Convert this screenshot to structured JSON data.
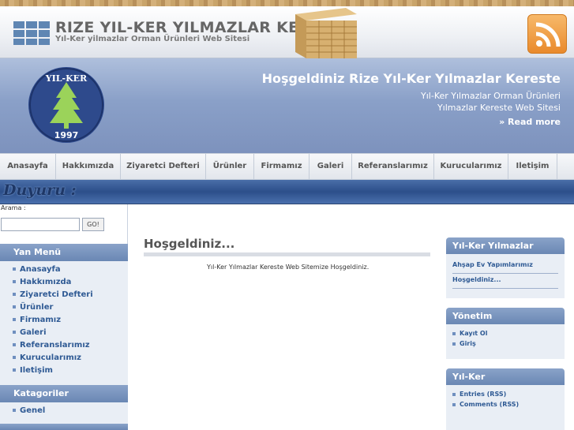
{
  "header": {
    "title": "RIZE YIL-KER YILMAZLAR KERESTE",
    "tagline": "Yıl-Ker yilmazlar Orman Ürünleri Web Sitesi",
    "rss_icon": "rss-feed-icon"
  },
  "banner": {
    "title": "Hoşgeldiniz Rize Yıl-Ker Yılmazlar Kereste",
    "sub_line1": "Yıl-Ker Yılmazlar Orman Ürünleri",
    "sub_line2": "Yılmazlar Kereste Web Sitesi",
    "read_more": "» Read more",
    "logo_text_top": "YIL-KER",
    "logo_year": "1997"
  },
  "nav": {
    "items": [
      {
        "label": "Anasayfa"
      },
      {
        "label": "Hakkımızda"
      },
      {
        "label": "Ziyaretci Defteri"
      },
      {
        "label": "Ürünler"
      },
      {
        "label": "Firmamız"
      },
      {
        "label": "Galeri"
      },
      {
        "label": "Referanslarımız"
      },
      {
        "label": "Kurucularımız"
      },
      {
        "label": "Iletişim"
      }
    ]
  },
  "announcement": {
    "label": "Duyuru :"
  },
  "search": {
    "label": "Arama :",
    "value": "",
    "button": "GO!"
  },
  "left_sidebar": {
    "menu_title": "Yan Menü",
    "menu_items": [
      {
        "label": "Anasayfa"
      },
      {
        "label": "Hakkımızda"
      },
      {
        "label": "Ziyaretci Defteri"
      },
      {
        "label": "Ürünler"
      },
      {
        "label": "Firmamız"
      },
      {
        "label": "Galeri"
      },
      {
        "label": "Referanslarımız"
      },
      {
        "label": "Kurucularımız"
      },
      {
        "label": "Iletişim"
      }
    ],
    "categories_title": "Katagoriler",
    "categories": [
      {
        "label": "Genel"
      }
    ]
  },
  "main": {
    "title": "Hoşgeldiniz...",
    "text": "Yıl-Ker Yılmazlar Kereste Web Sitemize Hoşgeldiniz."
  },
  "right_sidebar": {
    "box1": {
      "title": "Yıl-Ker Yılmazlar",
      "links": [
        {
          "label": "Ahşap Ev Yapımlarımız"
        },
        {
          "label": "Hoşgeldiniz..."
        }
      ]
    },
    "box2": {
      "title": "Yönetim",
      "links": [
        {
          "label": "Kayıt Ol"
        },
        {
          "label": "Giriş"
        }
      ]
    },
    "box3": {
      "title": "Yıl-Ker",
      "links": [
        {
          "label": "Entries (RSS)"
        },
        {
          "label": "Comments (RSS)"
        }
      ]
    }
  },
  "colors": {
    "accent": "#6a87b4",
    "link": "#2f5a94",
    "banner": "#8aa0c8"
  }
}
